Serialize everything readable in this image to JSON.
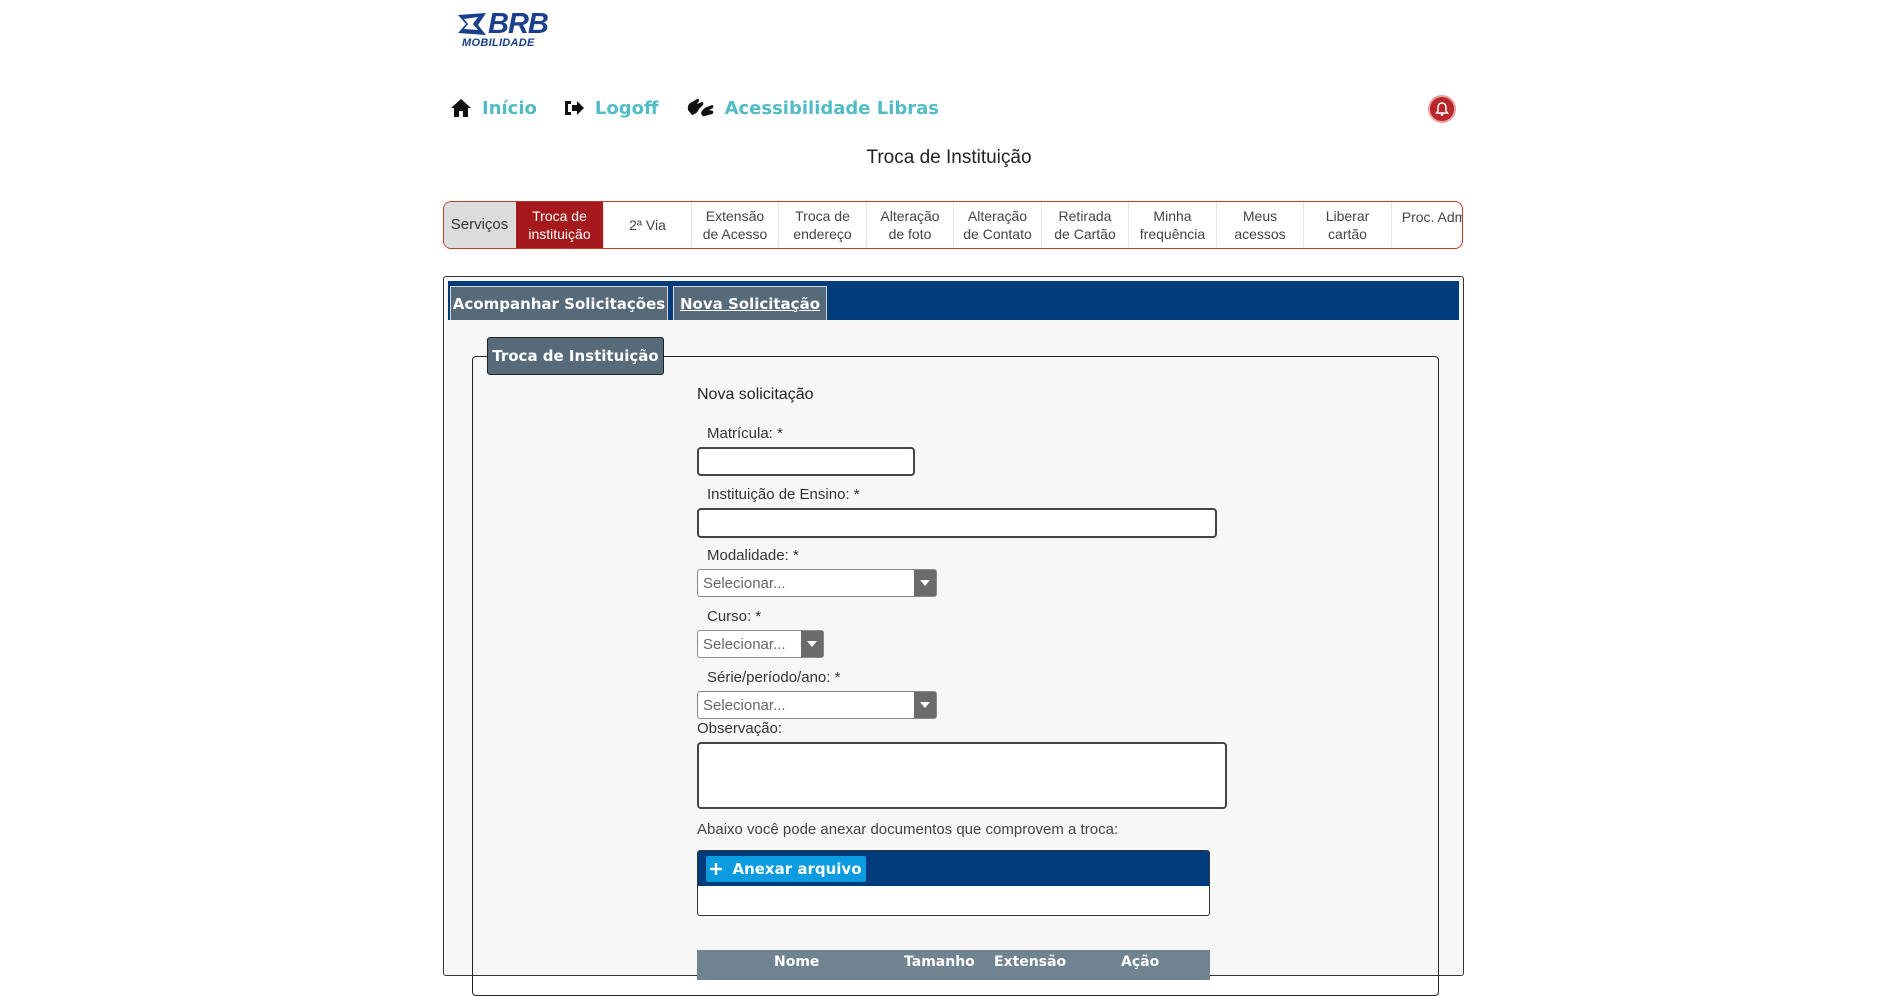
{
  "brand": {
    "logo_main": "BRB",
    "logo_sub": "MOBILIDADE",
    "color": "#1a3f8b"
  },
  "topnav": {
    "home": {
      "label": "Início",
      "icon": "home-icon"
    },
    "logoff": {
      "label": "Logoff",
      "icon": "logoff-icon"
    },
    "accessibility": {
      "label": "Acessibilidade Libras",
      "icon": "libras-icon"
    },
    "notification_icon": "bell-icon",
    "link_color": "#52bcc6"
  },
  "page_title": "Troca de Instituição",
  "service_tabs": [
    {
      "label": "Serviços"
    },
    {
      "line1": "Troca de",
      "line2": "instituição",
      "active": true
    },
    {
      "label": "2ª Via"
    },
    {
      "line1": "Extensão",
      "line2": "de Acesso"
    },
    {
      "line1": "Troca de",
      "line2": "endereço"
    },
    {
      "line1": "Alteração",
      "line2": "de foto"
    },
    {
      "line1": "Alteração",
      "line2": "de Contato"
    },
    {
      "line1": "Retirada",
      "line2": "de Cartão"
    },
    {
      "line1": "Minha",
      "line2": "frequência"
    },
    {
      "line1": "Meus",
      "line2": "acessos"
    },
    {
      "line1": "Liberar",
      "line2": "cartão"
    },
    {
      "label": "Proc. Adm."
    }
  ],
  "panel": {
    "tabs": [
      "Acompanhar Solicitações",
      "Nova Solicitação"
    ],
    "legend": "Troca de Instituição"
  },
  "form": {
    "heading": "Nova solicitação",
    "matricula_label": "Matrícula:  *",
    "matricula_value": "",
    "instituicao_label": "Instituição de Ensino:  *",
    "instituicao_value": "",
    "modalidade_label": "Modalidade:  *",
    "modalidade_value": "Selecionar...",
    "curso_label": "Curso:  *",
    "curso_value": "Selecionar...",
    "serie_label": "Série/período/ano:  *",
    "serie_value": "Selecionar...",
    "observacao_label": "Observação:",
    "observacao_value": "",
    "attach_hint": "Abaixo você pode anexar documentos que comprovem a troca:",
    "attach_button": "Anexar arquivo",
    "table_columns": [
      "Nome",
      "Tamanho",
      "Extensão",
      "Ação"
    ]
  },
  "colors": {
    "accent_red": "#a5191c",
    "navy": "#003b7b",
    "tab_gray": "#566a79",
    "button_blue": "#0a9be0"
  }
}
